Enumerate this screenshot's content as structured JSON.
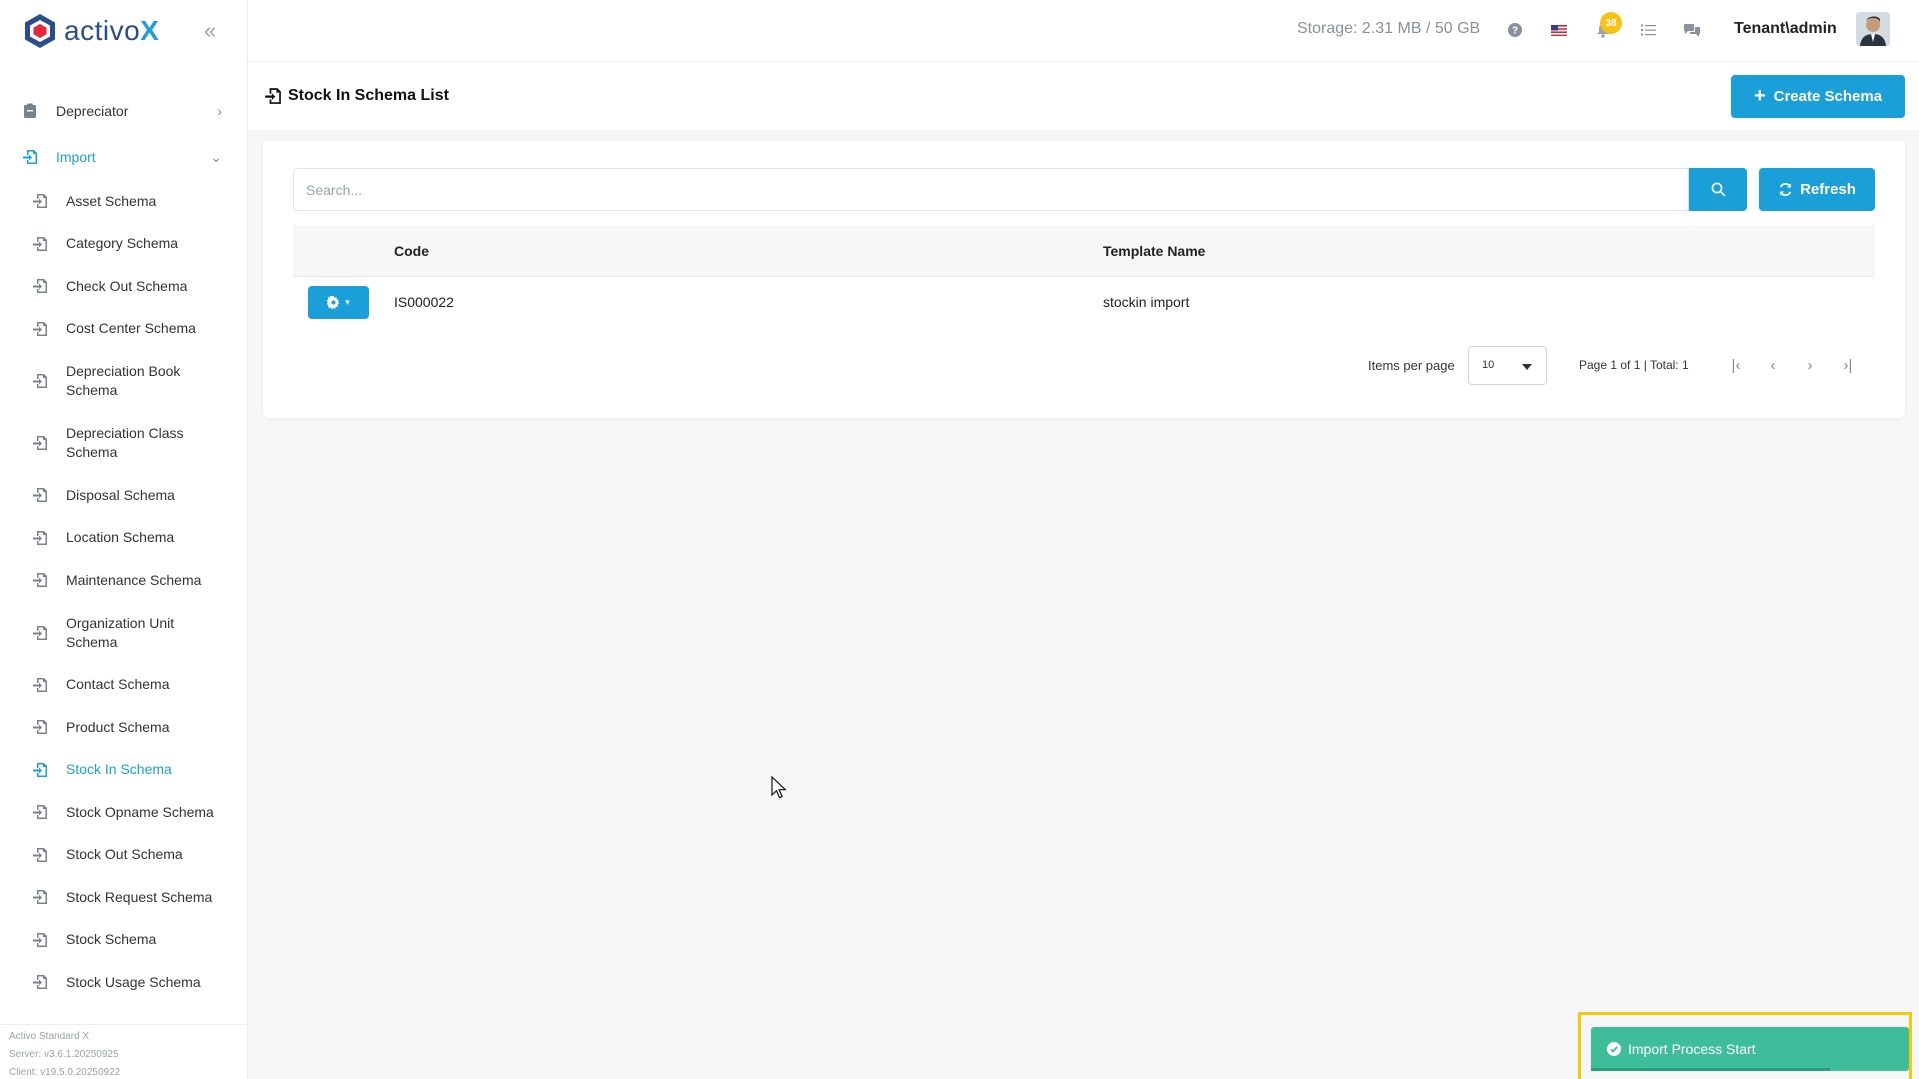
{
  "brand": {
    "name_prefix": "activo",
    "name_suffix": "X"
  },
  "colors": {
    "accent": "#1a9fd9",
    "brand_dark": "#2b4d8c",
    "badge": "#f4c316",
    "toast": "#3dbd99",
    "toast_highlight": "#f7c90b"
  },
  "sidebar": {
    "collapse_icon": "double-chevron-left-icon",
    "top_items": [
      {
        "label": "Depreciator",
        "icon": "clipboard-icon",
        "chevron": "›"
      },
      {
        "label": "Import",
        "icon": "import-icon",
        "chevron": "⌄"
      }
    ],
    "sub_items": [
      {
        "label": "Asset Schema",
        "multiline": false
      },
      {
        "label": "Category Schema",
        "multiline": false
      },
      {
        "label": "Check Out Schema",
        "multiline": false
      },
      {
        "label": "Cost Center Schema",
        "multiline": false
      },
      {
        "label": "Depreciation Book Schema",
        "multiline": true
      },
      {
        "label": "Depreciation Class Schema",
        "multiline": true
      },
      {
        "label": "Disposal Schema",
        "multiline": false
      },
      {
        "label": "Location Schema",
        "multiline": false
      },
      {
        "label": "Maintenance Schema",
        "multiline": false
      },
      {
        "label": "Organization Unit Schema",
        "multiline": true
      },
      {
        "label": "Contact Schema",
        "multiline": false
      },
      {
        "label": "Product Schema",
        "multiline": false
      },
      {
        "label": "Stock In Schema",
        "multiline": false,
        "active": true
      },
      {
        "label": "Stock Opname Schema",
        "multiline": false
      },
      {
        "label": "Stock Out Schema",
        "multiline": false
      },
      {
        "label": "Stock Request Schema",
        "multiline": false
      },
      {
        "label": "Stock Schema",
        "multiline": false
      },
      {
        "label": "Stock Usage Schema",
        "multiline": false
      }
    ],
    "footer": {
      "product": "Activo Standard X",
      "server": "Server: v3.6.1.20250925",
      "client": "Client: v19.5.0.20250922"
    }
  },
  "header": {
    "storage": "Storage: 2.31 MB / 50 GB",
    "notification_count": "38",
    "user": "Tenant\\admin",
    "icons": [
      "help-icon",
      "flag-us-icon",
      "bell-icon",
      "tasks-icon",
      "chat-icon"
    ]
  },
  "page": {
    "title": "Stock In Schema List",
    "create_button": "Create Schema"
  },
  "table": {
    "search_placeholder": "Search...",
    "refresh_label": "Refresh",
    "columns": [
      "Code",
      "Template Name"
    ],
    "rows": [
      {
        "code": "IS000022",
        "template_name": "stockin import"
      }
    ],
    "pagination": {
      "items_per_page_label": "Items per page",
      "items_per_page": "10",
      "page_info": "Page 1 of 1 | Total: 1"
    }
  },
  "toast": {
    "message": "Import Process Start",
    "progress": 0.75
  }
}
